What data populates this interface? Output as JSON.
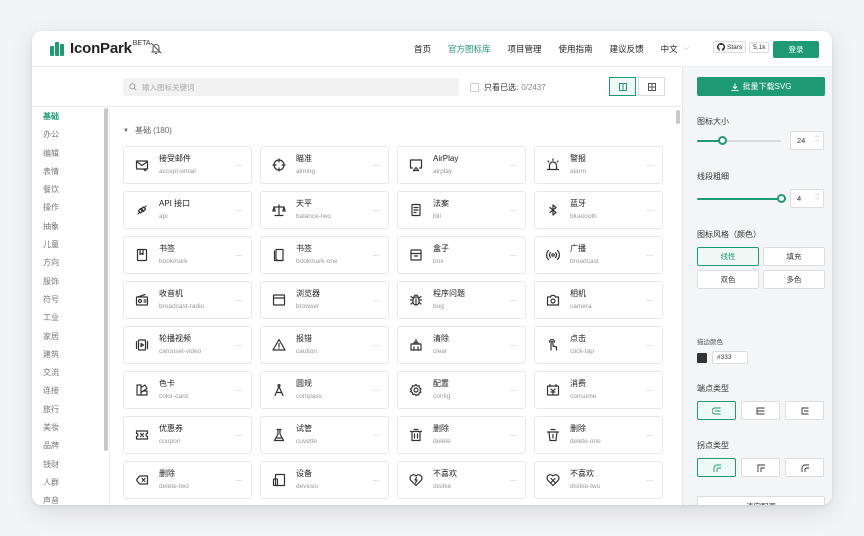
{
  "header": {
    "logo_text": "IconPark",
    "logo_beta": "BETA",
    "nav": [
      "首页",
      "官方图标库",
      "项目管理",
      "使用指南",
      "建议反馈"
    ],
    "nav_active_index": 1,
    "language": "中文",
    "github_label": "Stars",
    "github_count": "5.1k",
    "login": "登录"
  },
  "toolbar": {
    "search_placeholder": "输入图标关键词",
    "only_selected_label": "只看已选:",
    "selected_count": "0/2437"
  },
  "categories": [
    "基础",
    "办公",
    "编辑",
    "表情",
    "餐饮",
    "操作",
    "抽象",
    "儿童",
    "方向",
    "服饰",
    "符号",
    "工业",
    "家居",
    "建筑",
    "交流",
    "连接",
    "旅行",
    "美妆",
    "品牌",
    "钱财",
    "人群",
    "声音"
  ],
  "active_category_index": 0,
  "section": {
    "title": "基础 (180)"
  },
  "icons": [
    {
      "zh": "接受邮件",
      "en": "accept-email",
      "icon": "accept-email-icon"
    },
    {
      "zh": "瞄准",
      "en": "aiming",
      "icon": "aiming-icon"
    },
    {
      "zh": "AirPlay",
      "en": "airplay",
      "icon": "airplay-icon"
    },
    {
      "zh": "警报",
      "en": "alarm",
      "icon": "alarm-icon"
    },
    {
      "zh": "API 接口",
      "en": "api",
      "icon": "api-icon"
    },
    {
      "zh": "天平",
      "en": "balance-two",
      "icon": "balance-icon"
    },
    {
      "zh": "法案",
      "en": "bill",
      "icon": "bill-icon"
    },
    {
      "zh": "蓝牙",
      "en": "bluetooth",
      "icon": "bluetooth-icon"
    },
    {
      "zh": "书签",
      "en": "bookmark",
      "icon": "bookmark-icon"
    },
    {
      "zh": "书签",
      "en": "bookmark-one",
      "icon": "bookmark-one-icon"
    },
    {
      "zh": "盒子",
      "en": "box",
      "icon": "box-icon"
    },
    {
      "zh": "广播",
      "en": "broadcast",
      "icon": "broadcast-icon"
    },
    {
      "zh": "收音机",
      "en": "broadcast-radio",
      "icon": "radio-icon"
    },
    {
      "zh": "浏览器",
      "en": "browser",
      "icon": "browser-icon"
    },
    {
      "zh": "程序问题",
      "en": "bug",
      "icon": "bug-icon"
    },
    {
      "zh": "相机",
      "en": "camera",
      "icon": "camera-icon"
    },
    {
      "zh": "轮播视频",
      "en": "carousel-video",
      "icon": "carousel-video-icon"
    },
    {
      "zh": "报错",
      "en": "caution",
      "icon": "caution-icon"
    },
    {
      "zh": "清除",
      "en": "clear",
      "icon": "clear-icon"
    },
    {
      "zh": "点击",
      "en": "click-tap",
      "icon": "click-tap-icon"
    },
    {
      "zh": "色卡",
      "en": "color-card",
      "icon": "color-card-icon"
    },
    {
      "zh": "圆规",
      "en": "compass",
      "icon": "compass-icon"
    },
    {
      "zh": "配置",
      "en": "config",
      "icon": "config-icon"
    },
    {
      "zh": "消费",
      "en": "consume",
      "icon": "consume-icon"
    },
    {
      "zh": "优惠券",
      "en": "coupon",
      "icon": "coupon-icon"
    },
    {
      "zh": "试管",
      "en": "cuvette",
      "icon": "cuvette-icon"
    },
    {
      "zh": "删除",
      "en": "delete",
      "icon": "delete-icon"
    },
    {
      "zh": "删除",
      "en": "delete-one",
      "icon": "delete-one-icon"
    },
    {
      "zh": "删除",
      "en": "delete-two",
      "icon": "delete-two-icon"
    },
    {
      "zh": "设备",
      "en": "devices",
      "icon": "devices-icon"
    },
    {
      "zh": "不喜欢",
      "en": "dislike",
      "icon": "dislike-icon"
    },
    {
      "zh": "不喜欢",
      "en": "dislike-two",
      "icon": "dislike-two-icon"
    }
  ],
  "more_glyph": "···",
  "panel": {
    "download_label": "批量下载SVG",
    "size_label": "图标大小",
    "size_value": "24",
    "size_fraction": 0.3,
    "stroke_label": "线段粗细",
    "stroke_value": "4",
    "stroke_fraction": 1.0,
    "style_label": "图标风格（颜色）",
    "style_options": [
      "线性",
      "填充",
      "双色",
      "多色"
    ],
    "style_active_index": 0,
    "stroke_color_label": "描边颜色",
    "stroke_color": "#333",
    "linecap_label": "端点类型",
    "linejoin_label": "拐点类型",
    "reset_label": "清空配置"
  },
  "colors": {
    "accent": "#1f9b74"
  }
}
